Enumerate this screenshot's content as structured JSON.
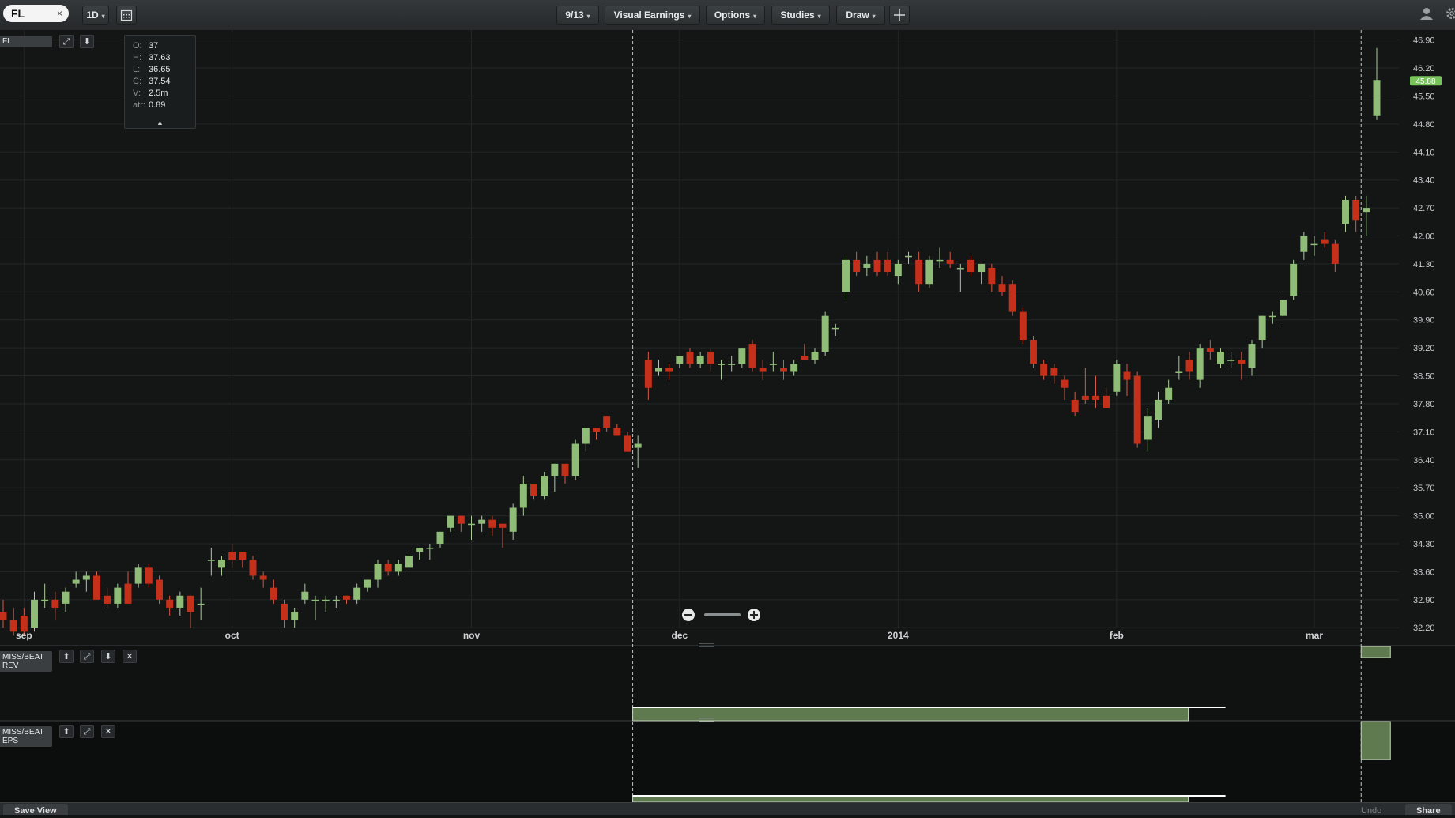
{
  "toolbar": {
    "symbol": "FL",
    "clear_glyph": "×",
    "interval": "1D",
    "date_button": "9/13",
    "visual_earnings": "Visual Earnings",
    "options": "Options",
    "studies": "Studies",
    "draw": "Draw",
    "caret": "▾",
    "icons": [
      "calendar-icon",
      "crosshair-icon",
      "user-icon",
      "gear-icon"
    ]
  },
  "panel_tag": "FL",
  "ohlc": [
    {
      "k": "O:",
      "v": "37"
    },
    {
      "k": "H:",
      "v": "37.63"
    },
    {
      "k": "L:",
      "v": "36.65"
    },
    {
      "k": "C:",
      "v": "37.54"
    },
    {
      "k": "V:",
      "v": "2.5m"
    },
    {
      "k": "atr:",
      "v": "0.89"
    }
  ],
  "subpanels": {
    "rev_line1": "MISS/BEAT",
    "rev_line2": "REV",
    "eps_line1": "MISS/BEAT",
    "eps_line2": "EPS"
  },
  "footer": {
    "save_view": "Save View",
    "undo": "Undo",
    "share": "Share"
  },
  "colors": {
    "up": "#8fbc77",
    "down": "#c5301b",
    "price_badge": "#79c35d",
    "earnings_fill": "#5f7a4f"
  },
  "chart_data": {
    "type": "candlestick",
    "y_ticks": [
      46.9,
      46.2,
      45.5,
      44.8,
      44.1,
      43.4,
      42.7,
      42.0,
      41.3,
      40.6,
      39.9,
      39.2,
      38.5,
      37.8,
      37.1,
      36.4,
      35.7,
      35.0,
      34.3,
      33.6,
      32.9,
      32.2
    ],
    "ylim": [
      31.75,
      47.15
    ],
    "last_price": "45.88",
    "x_labels": [
      {
        "label": "sep",
        "date": "2013-09-03"
      },
      {
        "label": "oct",
        "date": "2013-10-01"
      },
      {
        "label": "nov",
        "date": "2013-11-01"
      },
      {
        "label": "dec",
        "date": "2013-12-02"
      },
      {
        "label": "2014",
        "date": "2014-01-02"
      },
      {
        "label": "feb",
        "date": "2014-02-03"
      },
      {
        "label": "mar",
        "date": "2014-03-03"
      }
    ],
    "earnings_dates": [
      "2013-11-22",
      "2014-03-07"
    ],
    "candles": [
      {
        "date": "2013-08-29",
        "o": 32.6,
        "h": 32.9,
        "l": 32.2,
        "c": 32.4
      },
      {
        "date": "2013-08-30",
        "o": 32.4,
        "h": 32.7,
        "l": 32.0,
        "c": 32.1
      },
      {
        "date": "2013-09-03",
        "o": 32.5,
        "h": 32.7,
        "l": 32.0,
        "c": 32.1
      },
      {
        "date": "2013-09-04",
        "o": 32.2,
        "h": 33.1,
        "l": 32.1,
        "c": 32.9
      },
      {
        "date": "2013-09-05",
        "o": 32.9,
        "h": 33.3,
        "l": 32.7,
        "c": 32.9
      },
      {
        "date": "2013-09-06",
        "o": 32.9,
        "h": 33.1,
        "l": 32.4,
        "c": 32.7
      },
      {
        "date": "2013-09-09",
        "o": 32.8,
        "h": 33.2,
        "l": 32.6,
        "c": 33.1
      },
      {
        "date": "2013-09-10",
        "o": 33.3,
        "h": 33.6,
        "l": 33.2,
        "c": 33.4
      },
      {
        "date": "2013-09-11",
        "o": 33.4,
        "h": 33.6,
        "l": 33.1,
        "c": 33.5
      },
      {
        "date": "2013-09-12",
        "o": 33.5,
        "h": 33.6,
        "l": 32.9,
        "c": 32.9
      },
      {
        "date": "2013-09-13",
        "o": 33.0,
        "h": 33.2,
        "l": 32.7,
        "c": 32.8
      },
      {
        "date": "2013-09-16",
        "o": 32.8,
        "h": 33.3,
        "l": 32.7,
        "c": 33.2
      },
      {
        "date": "2013-09-17",
        "o": 33.3,
        "h": 33.6,
        "l": 32.8,
        "c": 32.8
      },
      {
        "date": "2013-09-18",
        "o": 33.3,
        "h": 33.8,
        "l": 33.2,
        "c": 33.7
      },
      {
        "date": "2013-09-19",
        "o": 33.7,
        "h": 33.8,
        "l": 33.2,
        "c": 33.3
      },
      {
        "date": "2013-09-20",
        "o": 33.4,
        "h": 33.5,
        "l": 32.8,
        "c": 32.9
      },
      {
        "date": "2013-09-23",
        "o": 32.9,
        "h": 33.0,
        "l": 32.5,
        "c": 32.7
      },
      {
        "date": "2013-09-24",
        "o": 32.7,
        "h": 33.1,
        "l": 32.5,
        "c": 33.0
      },
      {
        "date": "2013-09-25",
        "o": 33.0,
        "h": 33.0,
        "l": 32.2,
        "c": 32.6
      },
      {
        "date": "2013-09-26",
        "o": 32.8,
        "h": 33.2,
        "l": 32.4,
        "c": 32.8
      },
      {
        "date": "2013-09-27",
        "o": 33.9,
        "h": 34.2,
        "l": 33.5,
        "c": 33.9
      },
      {
        "date": "2013-09-30",
        "o": 33.7,
        "h": 34.0,
        "l": 33.5,
        "c": 33.9
      },
      {
        "date": "2013-10-01",
        "o": 34.1,
        "h": 34.3,
        "l": 33.7,
        "c": 33.9
      },
      {
        "date": "2013-10-02",
        "o": 34.1,
        "h": 34.1,
        "l": 33.7,
        "c": 33.9
      },
      {
        "date": "2013-10-03",
        "o": 33.9,
        "h": 34.0,
        "l": 33.4,
        "c": 33.5
      },
      {
        "date": "2013-10-04",
        "o": 33.5,
        "h": 33.6,
        "l": 33.2,
        "c": 33.4
      },
      {
        "date": "2013-10-07",
        "o": 33.2,
        "h": 33.4,
        "l": 32.8,
        "c": 32.9
      },
      {
        "date": "2013-10-08",
        "o": 32.8,
        "h": 32.9,
        "l": 32.2,
        "c": 32.4
      },
      {
        "date": "2013-10-09",
        "o": 32.4,
        "h": 32.7,
        "l": 32.2,
        "c": 32.6
      },
      {
        "date": "2013-10-10",
        "o": 32.9,
        "h": 33.3,
        "l": 32.8,
        "c": 33.1
      },
      {
        "date": "2013-10-11",
        "o": 32.9,
        "h": 33.0,
        "l": 32.4,
        "c": 32.9
      },
      {
        "date": "2013-10-14",
        "o": 32.9,
        "h": 33.0,
        "l": 32.6,
        "c": 32.9
      },
      {
        "date": "2013-10-15",
        "o": 32.9,
        "h": 33.0,
        "l": 32.7,
        "c": 32.9
      },
      {
        "date": "2013-10-16",
        "o": 33.0,
        "h": 33.0,
        "l": 32.8,
        "c": 32.9
      },
      {
        "date": "2013-10-17",
        "o": 32.9,
        "h": 33.3,
        "l": 32.8,
        "c": 33.2
      },
      {
        "date": "2013-10-18",
        "o": 33.2,
        "h": 33.4,
        "l": 33.1,
        "c": 33.4
      },
      {
        "date": "2013-10-21",
        "o": 33.4,
        "h": 33.9,
        "l": 33.2,
        "c": 33.8
      },
      {
        "date": "2013-10-22",
        "o": 33.8,
        "h": 33.9,
        "l": 33.5,
        "c": 33.6
      },
      {
        "date": "2013-10-23",
        "o": 33.6,
        "h": 33.9,
        "l": 33.5,
        "c": 33.8
      },
      {
        "date": "2013-10-24",
        "o": 33.7,
        "h": 34.0,
        "l": 33.6,
        "c": 34.0
      },
      {
        "date": "2013-10-25",
        "o": 34.1,
        "h": 34.2,
        "l": 33.9,
        "c": 34.2
      },
      {
        "date": "2013-10-28",
        "o": 34.2,
        "h": 34.3,
        "l": 33.9,
        "c": 34.2
      },
      {
        "date": "2013-10-29",
        "o": 34.3,
        "h": 34.6,
        "l": 34.2,
        "c": 34.6
      },
      {
        "date": "2013-10-30",
        "o": 34.7,
        "h": 35.0,
        "l": 34.6,
        "c": 35.0
      },
      {
        "date": "2013-10-31",
        "o": 35.0,
        "h": 35.0,
        "l": 34.6,
        "c": 34.8
      },
      {
        "date": "2013-11-01",
        "o": 34.8,
        "h": 35.0,
        "l": 34.4,
        "c": 34.8
      },
      {
        "date": "2013-11-04",
        "o": 34.8,
        "h": 35.0,
        "l": 34.6,
        "c": 34.9
      },
      {
        "date": "2013-11-05",
        "o": 34.9,
        "h": 35.0,
        "l": 34.5,
        "c": 34.7
      },
      {
        "date": "2013-11-06",
        "o": 34.8,
        "h": 34.8,
        "l": 34.2,
        "c": 34.7
      },
      {
        "date": "2013-11-07",
        "o": 34.6,
        "h": 35.3,
        "l": 34.4,
        "c": 35.2
      },
      {
        "date": "2013-11-08",
        "o": 35.2,
        "h": 36.0,
        "l": 35.0,
        "c": 35.8
      },
      {
        "date": "2013-11-11",
        "o": 35.8,
        "h": 35.8,
        "l": 35.4,
        "c": 35.5
      },
      {
        "date": "2013-11-12",
        "o": 35.5,
        "h": 36.1,
        "l": 35.4,
        "c": 36.0
      },
      {
        "date": "2013-11-13",
        "o": 36.0,
        "h": 36.3,
        "l": 35.6,
        "c": 36.3
      },
      {
        "date": "2013-11-14",
        "o": 36.3,
        "h": 36.3,
        "l": 35.8,
        "c": 36.0
      },
      {
        "date": "2013-11-15",
        "o": 36.0,
        "h": 36.9,
        "l": 35.9,
        "c": 36.8
      },
      {
        "date": "2013-11-18",
        "o": 36.8,
        "h": 37.2,
        "l": 36.6,
        "c": 37.2
      },
      {
        "date": "2013-11-19",
        "o": 37.2,
        "h": 37.2,
        "l": 36.9,
        "c": 37.1
      },
      {
        "date": "2013-11-20",
        "o": 37.5,
        "h": 37.5,
        "l": 37.1,
        "c": 37.2
      },
      {
        "date": "2013-11-21",
        "o": 37.2,
        "h": 37.3,
        "l": 37.0,
        "c": 37.0
      },
      {
        "date": "2013-11-22",
        "o": 37.0,
        "h": 37.1,
        "l": 36.6,
        "c": 36.6
      },
      {
        "date": "2013-11-25",
        "o": 36.7,
        "h": 37.0,
        "l": 36.2,
        "c": 36.8
      },
      {
        "date": "2013-11-26",
        "o": 38.9,
        "h": 39.1,
        "l": 37.9,
        "c": 38.2
      },
      {
        "date": "2013-11-27",
        "o": 38.6,
        "h": 38.9,
        "l": 38.5,
        "c": 38.7
      },
      {
        "date": "2013-11-29",
        "o": 38.7,
        "h": 38.8,
        "l": 38.4,
        "c": 38.6
      },
      {
        "date": "2013-12-02",
        "o": 38.8,
        "h": 39.0,
        "l": 38.7,
        "c": 39.0
      },
      {
        "date": "2013-12-03",
        "o": 39.1,
        "h": 39.2,
        "l": 38.7,
        "c": 38.8
      },
      {
        "date": "2013-12-04",
        "o": 38.8,
        "h": 39.1,
        "l": 38.7,
        "c": 39.0
      },
      {
        "date": "2013-12-05",
        "o": 39.1,
        "h": 39.2,
        "l": 38.6,
        "c": 38.8
      },
      {
        "date": "2013-12-06",
        "o": 38.8,
        "h": 38.9,
        "l": 38.4,
        "c": 38.8
      },
      {
        "date": "2013-12-09",
        "o": 38.8,
        "h": 39.0,
        "l": 38.6,
        "c": 38.8
      },
      {
        "date": "2013-12-10",
        "o": 38.8,
        "h": 39.2,
        "l": 38.7,
        "c": 39.2
      },
      {
        "date": "2013-12-11",
        "o": 39.3,
        "h": 39.4,
        "l": 38.6,
        "c": 38.7
      },
      {
        "date": "2013-12-12",
        "o": 38.7,
        "h": 38.9,
        "l": 38.4,
        "c": 38.6
      },
      {
        "date": "2013-12-13",
        "o": 38.8,
        "h": 39.1,
        "l": 38.6,
        "c": 38.8
      },
      {
        "date": "2013-12-16",
        "o": 38.7,
        "h": 38.9,
        "l": 38.4,
        "c": 38.6
      },
      {
        "date": "2013-12-17",
        "o": 38.6,
        "h": 38.9,
        "l": 38.5,
        "c": 38.8
      },
      {
        "date": "2013-12-18",
        "o": 39.0,
        "h": 39.3,
        "l": 38.9,
        "c": 38.9
      },
      {
        "date": "2013-12-19",
        "o": 38.9,
        "h": 39.2,
        "l": 38.8,
        "c": 39.1
      },
      {
        "date": "2013-12-20",
        "o": 39.1,
        "h": 40.1,
        "l": 39.0,
        "c": 40.0
      },
      {
        "date": "2013-12-23",
        "o": 39.7,
        "h": 39.8,
        "l": 39.5,
        "c": 39.7
      },
      {
        "date": "2013-12-24",
        "o": 40.6,
        "h": 41.5,
        "l": 40.4,
        "c": 41.4
      },
      {
        "date": "2013-12-26",
        "o": 41.4,
        "h": 41.6,
        "l": 41.0,
        "c": 41.1
      },
      {
        "date": "2013-12-27",
        "o": 41.2,
        "h": 41.5,
        "l": 41.0,
        "c": 41.3
      },
      {
        "date": "2013-12-30",
        "o": 41.4,
        "h": 41.6,
        "l": 41.0,
        "c": 41.1
      },
      {
        "date": "2013-12-31",
        "o": 41.4,
        "h": 41.6,
        "l": 41.0,
        "c": 41.1
      },
      {
        "date": "2014-01-02",
        "o": 41.0,
        "h": 41.4,
        "l": 40.8,
        "c": 41.3
      },
      {
        "date": "2014-01-03",
        "o": 41.5,
        "h": 41.6,
        "l": 41.3,
        "c": 41.5
      },
      {
        "date": "2014-01-06",
        "o": 41.4,
        "h": 41.6,
        "l": 40.6,
        "c": 40.8
      },
      {
        "date": "2014-01-07",
        "o": 40.8,
        "h": 41.5,
        "l": 40.7,
        "c": 41.4
      },
      {
        "date": "2014-01-08",
        "o": 41.4,
        "h": 41.7,
        "l": 41.2,
        "c": 41.4
      },
      {
        "date": "2014-01-09",
        "o": 41.4,
        "h": 41.6,
        "l": 41.2,
        "c": 41.3
      },
      {
        "date": "2014-01-10",
        "o": 41.2,
        "h": 41.3,
        "l": 40.6,
        "c": 41.2
      },
      {
        "date": "2014-01-13",
        "o": 41.4,
        "h": 41.5,
        "l": 41.0,
        "c": 41.1
      },
      {
        "date": "2014-01-14",
        "o": 41.1,
        "h": 41.3,
        "l": 40.8,
        "c": 41.3
      },
      {
        "date": "2014-01-15",
        "o": 41.2,
        "h": 41.3,
        "l": 40.6,
        "c": 40.8
      },
      {
        "date": "2014-01-16",
        "o": 40.8,
        "h": 41.0,
        "l": 40.5,
        "c": 40.6
      },
      {
        "date": "2014-01-17",
        "o": 40.8,
        "h": 40.9,
        "l": 40.0,
        "c": 40.1
      },
      {
        "date": "2014-01-21",
        "o": 40.1,
        "h": 40.2,
        "l": 39.3,
        "c": 39.4
      },
      {
        "date": "2014-01-22",
        "o": 39.4,
        "h": 39.5,
        "l": 38.7,
        "c": 38.8
      },
      {
        "date": "2014-01-23",
        "o": 38.8,
        "h": 38.9,
        "l": 38.4,
        "c": 38.5
      },
      {
        "date": "2014-01-24",
        "o": 38.7,
        "h": 38.8,
        "l": 38.3,
        "c": 38.5
      },
      {
        "date": "2014-01-27",
        "o": 38.4,
        "h": 38.5,
        "l": 37.9,
        "c": 38.2
      },
      {
        "date": "2014-01-28",
        "o": 37.9,
        "h": 38.1,
        "l": 37.5,
        "c": 37.6
      },
      {
        "date": "2014-01-29",
        "o": 38.0,
        "h": 38.7,
        "l": 37.8,
        "c": 37.9
      },
      {
        "date": "2014-01-30",
        "o": 38.0,
        "h": 38.5,
        "l": 37.7,
        "c": 37.9
      },
      {
        "date": "2014-01-31",
        "o": 38.0,
        "h": 38.2,
        "l": 37.7,
        "c": 37.7
      },
      {
        "date": "2014-02-03",
        "o": 38.1,
        "h": 38.9,
        "l": 38.0,
        "c": 38.8
      },
      {
        "date": "2014-02-04",
        "o": 38.6,
        "h": 38.8,
        "l": 38.0,
        "c": 38.4
      },
      {
        "date": "2014-02-05",
        "o": 38.5,
        "h": 38.6,
        "l": 36.7,
        "c": 36.8
      },
      {
        "date": "2014-02-06",
        "o": 36.9,
        "h": 37.7,
        "l": 36.6,
        "c": 37.5
      },
      {
        "date": "2014-02-07",
        "o": 37.4,
        "h": 38.1,
        "l": 37.2,
        "c": 37.9
      },
      {
        "date": "2014-02-10",
        "o": 37.9,
        "h": 38.4,
        "l": 37.8,
        "c": 38.2
      },
      {
        "date": "2014-02-11",
        "o": 38.6,
        "h": 39.0,
        "l": 38.4,
        "c": 38.6
      },
      {
        "date": "2014-02-12",
        "o": 38.9,
        "h": 39.1,
        "l": 38.4,
        "c": 38.6
      },
      {
        "date": "2014-02-13",
        "o": 38.4,
        "h": 39.3,
        "l": 38.2,
        "c": 39.2
      },
      {
        "date": "2014-02-14",
        "o": 39.2,
        "h": 39.4,
        "l": 38.9,
        "c": 39.1
      },
      {
        "date": "2014-02-18",
        "o": 38.8,
        "h": 39.2,
        "l": 38.7,
        "c": 39.1
      },
      {
        "date": "2014-02-19",
        "o": 38.9,
        "h": 39.1,
        "l": 38.7,
        "c": 38.9
      },
      {
        "date": "2014-02-20",
        "o": 38.9,
        "h": 39.1,
        "l": 38.4,
        "c": 38.8
      },
      {
        "date": "2014-02-21",
        "o": 38.7,
        "h": 39.4,
        "l": 38.5,
        "c": 39.3
      },
      {
        "date": "2014-02-24",
        "o": 39.4,
        "h": 40.0,
        "l": 39.2,
        "c": 40.0
      },
      {
        "date": "2014-02-25",
        "o": 40.0,
        "h": 40.1,
        "l": 39.8,
        "c": 40.0
      },
      {
        "date": "2014-02-26",
        "o": 40.0,
        "h": 40.5,
        "l": 39.8,
        "c": 40.4
      },
      {
        "date": "2014-02-27",
        "o": 40.5,
        "h": 41.4,
        "l": 40.4,
        "c": 41.3
      },
      {
        "date": "2014-02-28",
        "o": 41.6,
        "h": 42.1,
        "l": 41.4,
        "c": 42.0
      },
      {
        "date": "2014-03-03",
        "o": 41.8,
        "h": 42.0,
        "l": 41.5,
        "c": 41.8
      },
      {
        "date": "2014-03-04",
        "o": 41.9,
        "h": 42.1,
        "l": 41.7,
        "c": 41.8
      },
      {
        "date": "2014-03-05",
        "o": 41.8,
        "h": 41.9,
        "l": 41.1,
        "c": 41.3
      },
      {
        "date": "2014-03-06",
        "o": 42.3,
        "h": 43.0,
        "l": 42.1,
        "c": 42.9
      },
      {
        "date": "2014-03-07",
        "o": 42.9,
        "h": 43.0,
        "l": 42.1,
        "c": 42.4
      },
      {
        "date": "2014-03-10",
        "o": 42.6,
        "h": 43.0,
        "l": 42.0,
        "c": 42.7
      },
      {
        "date": "2014-03-11",
        "o": 45.0,
        "h": 46.7,
        "l": 44.9,
        "c": 45.9
      }
    ]
  }
}
